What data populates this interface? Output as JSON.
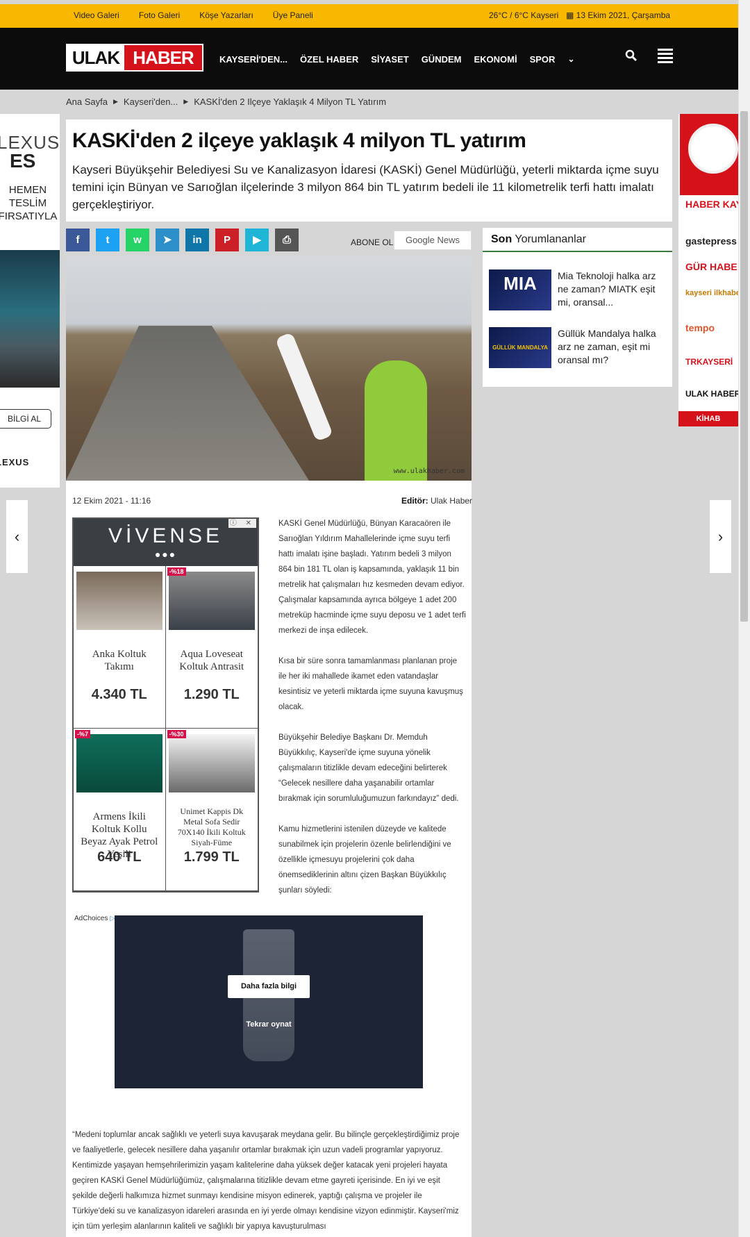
{
  "topbar": {
    "links": [
      "Video Galeri",
      "Foto Galeri",
      "Köşe Yazarları",
      "Üye Paneli"
    ],
    "weather": "26°C / 6°C Kayseri",
    "date": "13 Ekim 2021, Çarşamba"
  },
  "header": {
    "logo_left": "ULAK",
    "logo_right": "HABER",
    "nav": [
      "KAYSERİ'DEN...",
      "ÖZEL HABER",
      "SİYASET",
      "GÜNDEM",
      "EKONOMİ",
      "SPOR"
    ]
  },
  "breadcrumb": [
    "Ana Sayfa",
    "Kayseri'den...",
    "KASKİ'den 2 Ilçeye Yaklaşık 4 Milyon TL Yatırım"
  ],
  "left_ad": {
    "brand": "LEXUS",
    "model": "ES",
    "promo": "HEMEN TESLİM FIRSATIYLA",
    "button": "BİLGİ AL",
    "footer": "LEXUS"
  },
  "article": {
    "title": "KASKİ'den 2 ilçeye yaklaşık 4 milyon TL yatırım",
    "summary": "Kayseri Büyükşehir Belediyesi Su ve Kanalizasyon İdaresi (KASKİ) Genel Müdürlüğü, yeterli miktarda içme suyu temini için Bünyan ve Sarıoğlan ilçelerinde 3 milyon 864 bin TL yatırım bedeli ile 11 kilometrelik terfi hattı imalatı gerçekleştiriyor.",
    "date": "12 Ekim 2021 - 11:16",
    "editor_label": "Editör:",
    "editor_name": "Ulak Haber",
    "watermark": "www.ulakhaber.com",
    "paragraphs": [
      "KASKİ Genel Müdürlüğü, Bünyan Karacaören ile Sarıoğlan Yıldırım Mahallelerinde içme suyu terfi hattı imalatı işine başladı. Yatırım bedeli 3 milyon 864 bin 181 TL olan iş kapsamında, yaklaşık 11 bin metrelik hat çalışmaları hız kesmeden devam ediyor.  Çalışmalar kapsamında ayrıca bölgeye 1 adet 200 metreküp hacminde içme suyu deposu ve 1 adet terfi merkezi de inşa edilecek.",
      "Kısa bir süre sonra tamamlanması planlanan proje ile her iki mahallede ikamet eden vatandaşlar kesintisiz ve yeterli miktarda içme suyuna kavuşmuş olacak.",
      "Büyükşehir Belediye Başkanı Dr. Memduh Büyükkılıç, Kayseri'de içme suyuna yönelik çalışmaların titizlikle devam edeceğini belirterek “Gelecek nesillere daha yaşanabilir ortamlar bırakmak için sorumluluğumuzun farkındayız” dedi.",
      "Kamu hizmetlerini istenilen düzeyde ve kalitede sunabilmek için projelerin özenle belirlendiğini ve özellikle içmesuyu projelerini çok daha önemsediklerinin altını çizen Başkan Büyükkılıç şunları söyledi:"
    ],
    "quote": "“Medeni toplumlar ancak sağlıklı ve yeterli suya kavuşarak meydana gelir. Bu bilinçle gerçekleştirdiğimiz proje ve faaliyetlerle, gelecek nesillere daha yaşanılır ortamlar bırakmak için uzun vadeli programlar yapıyoruz.  Kentimizde yaşayan hemşehrilerimizin yaşam kalitelerine daha yüksek değer katacak yeni projeleri hayata geçiren KASKİ Genel Müdürlüğümüz, çalışmalarına titizlikle devam etme gayreti içerisinde. En iyi ve eşit şekilde değerli halkımıza hizmet sunmayı kendisine misyon edinerek, yaptığı çalışma ve projeler ile Türkiye'deki su ve kanalizasyon idareleri arasında en iyi yerde olmayı kendisine vizyon edinmiştir. Kayseri'miz için tüm yerleşim alanlarının kaliteli ve sağlıklı bir yapıya kavuşturulması"
  },
  "share": {
    "abone": "ABONE OL",
    "gnews": "Google News",
    "icons": [
      "facebook-icon",
      "twitter-icon",
      "whatsapp-icon",
      "telegram-icon",
      "linkedin-icon",
      "pinterest-icon",
      "play-icon",
      "print-icon"
    ],
    "glyphs": [
      "f",
      "t",
      "w",
      "➤",
      "in",
      "P",
      "▶",
      "⎙"
    ],
    "colors": [
      "#3b5998",
      "#1da1f2",
      "#25d366",
      "#2c8fc9",
      "#0e76a8",
      "#cb2027",
      "#1fb5d6",
      "#555555"
    ]
  },
  "ad_grid": {
    "brand": "VİVENSE",
    "dots": "●●●",
    "close": "ⓘ ✕",
    "products": [
      {
        "name": "Anka Koltuk Takımı",
        "price": "4.340 TL",
        "discount": ""
      },
      {
        "name": "Aqua Loveseat Koltuk Antrasit",
        "price": "1.290 TL",
        "discount": "-%18"
      },
      {
        "name": "Armens İkili Koltuk Kollu Beyaz Ayak Petrol Yeşili",
        "price": "640 TL",
        "discount": "-%7"
      },
      {
        "name": "Unimet Kappis Dk Metal Sofa Sedir 70X140 İkili Koltuk Siyah-Füme",
        "price": "1.799 TL",
        "discount": "-%30"
      }
    ]
  },
  "video_ad": {
    "adchoices": "AdChoices",
    "more": "Daha fazla bilgi",
    "replay": "Tekrar oynat"
  },
  "sidebar": {
    "head_bold": "Son",
    "head_rest": "Yorumlananlar",
    "items": [
      {
        "thumb": "MIA",
        "text": "Mia Teknoloji halka arz ne zaman? MIATK eşit mi, oransal..."
      },
      {
        "thumb": "GÜLLÜK MANDALYA",
        "text": "Güllük Mandalya halka arz ne zaman, eşit mi oransal mı?"
      }
    ]
  },
  "right_ad": {
    "logos": [
      "HABER KAYSER",
      "gastepress",
      "GÜR HABE",
      "kayseri ilkhaber",
      "tempo",
      "TRKAYSERİ",
      "ULAK HABER"
    ],
    "kihab": "KİHAB"
  },
  "colors": {
    "topbar": "#f9b800",
    "header": "#0c0c0c",
    "brand_red": "#d5121a",
    "sidebar_accent": "#3a7a3a"
  }
}
